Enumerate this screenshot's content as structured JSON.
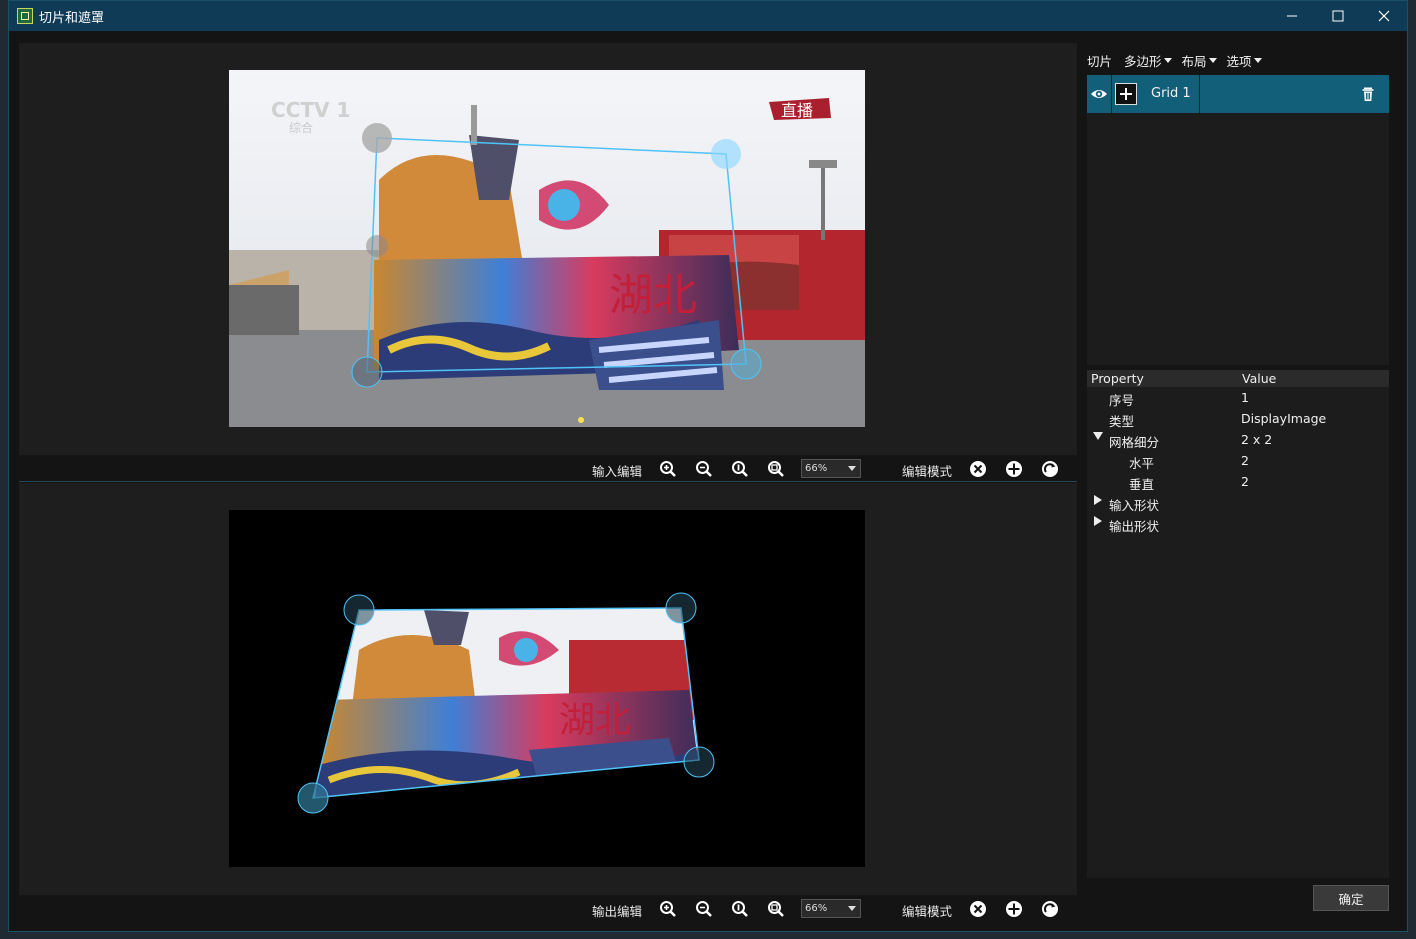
{
  "window": {
    "title": "切片和遮罩"
  },
  "top_panel": {
    "toolbar_label": "输入编辑",
    "zoom_value": "66%",
    "mode_label": "编辑模式",
    "overlay": {
      "cctv": "CCTV 1",
      "cctv_sub": "综合",
      "live": "直播",
      "banner": "湖北"
    }
  },
  "bottom_panel": {
    "toolbar_label": "输出编辑",
    "zoom_value": "66%",
    "mode_label": "编辑模式",
    "overlay": {
      "banner": "湖北"
    }
  },
  "menu": {
    "items": [
      "切片",
      "多边形",
      "布局",
      "选项"
    ]
  },
  "items": [
    {
      "name": "Grid 1"
    }
  ],
  "properties": {
    "header_property": "Property",
    "header_value": "Value",
    "rows": [
      {
        "name": "序号",
        "value": "1"
      },
      {
        "name": "类型",
        "value": "DisplayImage"
      },
      {
        "name": "网格细分",
        "value": "2 x 2"
      },
      {
        "name": "水平",
        "value": "2"
      },
      {
        "name": "垂直",
        "value": "2"
      },
      {
        "name": "输入形状",
        "value": ""
      },
      {
        "name": "输出形状",
        "value": ""
      }
    ]
  },
  "buttons": {
    "ok": "确定"
  },
  "colors": {
    "accent": "#125f79",
    "title_bar": "#0f3b56",
    "handle": "#4fc3f7"
  }
}
